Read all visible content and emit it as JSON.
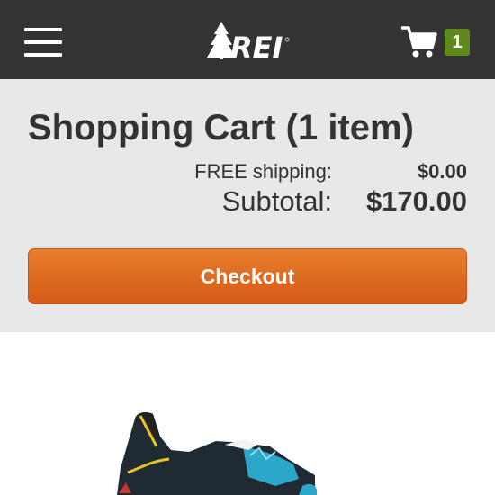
{
  "header": {
    "brand": "REI",
    "cart_count": "1"
  },
  "cart": {
    "title": "Shopping Cart (1 item)",
    "shipping_label": "FREE shipping:",
    "shipping_value": "$0.00",
    "subtotal_label": "Subtotal:",
    "subtotal_value": "$170.00",
    "checkout_label": "Checkout"
  },
  "icons": {
    "menu": "hamburger-menu-icon",
    "logo": "rei-logo",
    "cart": "shopping-cart-icon"
  },
  "colors": {
    "header_bg": "#333333",
    "summary_bg": "#e8e8e8",
    "checkout": "#e0661f",
    "badge": "#5d8a1a"
  }
}
